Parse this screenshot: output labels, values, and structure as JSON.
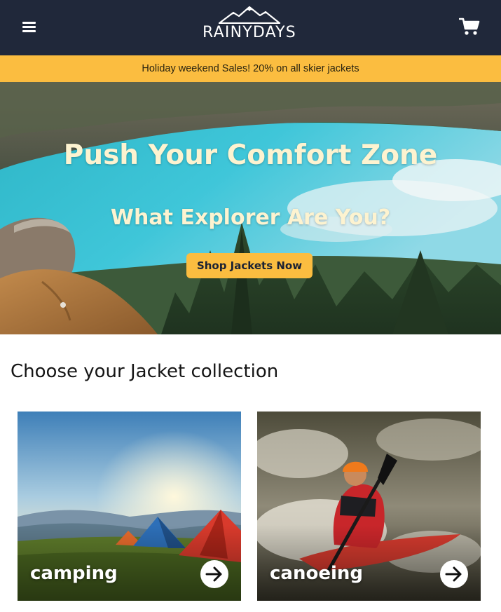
{
  "header": {
    "brand": "RAINYDAYS",
    "menu_icon": "hamburger-menu-icon",
    "cart_icon": "shopping-cart-icon",
    "background": "#20283a"
  },
  "promo": {
    "text": "Holiday weekend Sales! 20% on all skier jackets",
    "background": "#fbbd40"
  },
  "hero": {
    "title": "Push Your Comfort Zone",
    "subtitle": "What Explorer Are You?",
    "cta_label": "Shop Jackets Now",
    "text_color": "#fdf3d0",
    "cta_color": "#fbbd40"
  },
  "collection": {
    "heading": "Choose your Jacket collection",
    "cards": [
      {
        "label": "camping",
        "icon": "arrow-right-icon"
      },
      {
        "label": "canoeing",
        "icon": "arrow-right-icon"
      }
    ]
  }
}
